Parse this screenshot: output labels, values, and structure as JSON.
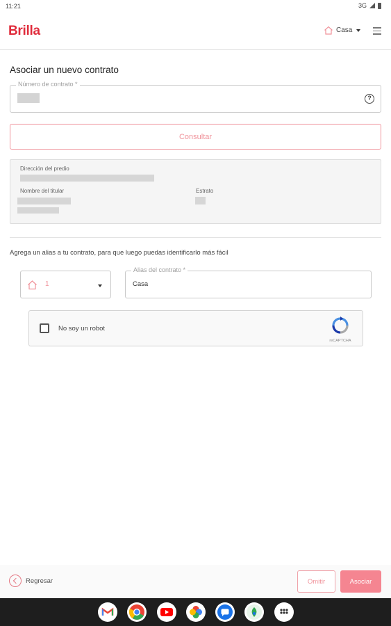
{
  "status_bar": {
    "time": "11:21",
    "network": "3G"
  },
  "header": {
    "logo": "Brilla",
    "home_selector": "Casa"
  },
  "page_title": "Asociar un nuevo contrato",
  "contract_field": {
    "label": "Número de contrato *",
    "help": "?"
  },
  "consult_button": "Consultar",
  "info": {
    "address_label": "Dirección del predio",
    "holder_label": "Nombre del titular",
    "stratum_label": "Estrato"
  },
  "alias_hint": "Agrega un alias a tu contrato, para que luego puedas identificarlo más fácil",
  "icon_select": {
    "value": "1"
  },
  "alias_field": {
    "label": "Alias del contrato *",
    "value": "Casa"
  },
  "recaptcha": {
    "label": "No soy un robot",
    "brand": "reCAPTCHA"
  },
  "footer": {
    "back": "Regresar",
    "skip": "Omitir",
    "associate": "Asociar"
  },
  "taskbar": {
    "apps": [
      "gmail-icon",
      "chrome-icon",
      "youtube-icon",
      "photos-icon",
      "messages-icon",
      "app-icon",
      "app-drawer-icon"
    ]
  },
  "colors": {
    "brand": "#e02b3b",
    "accent": "#f0939b",
    "primary_button": "#f58591"
  }
}
